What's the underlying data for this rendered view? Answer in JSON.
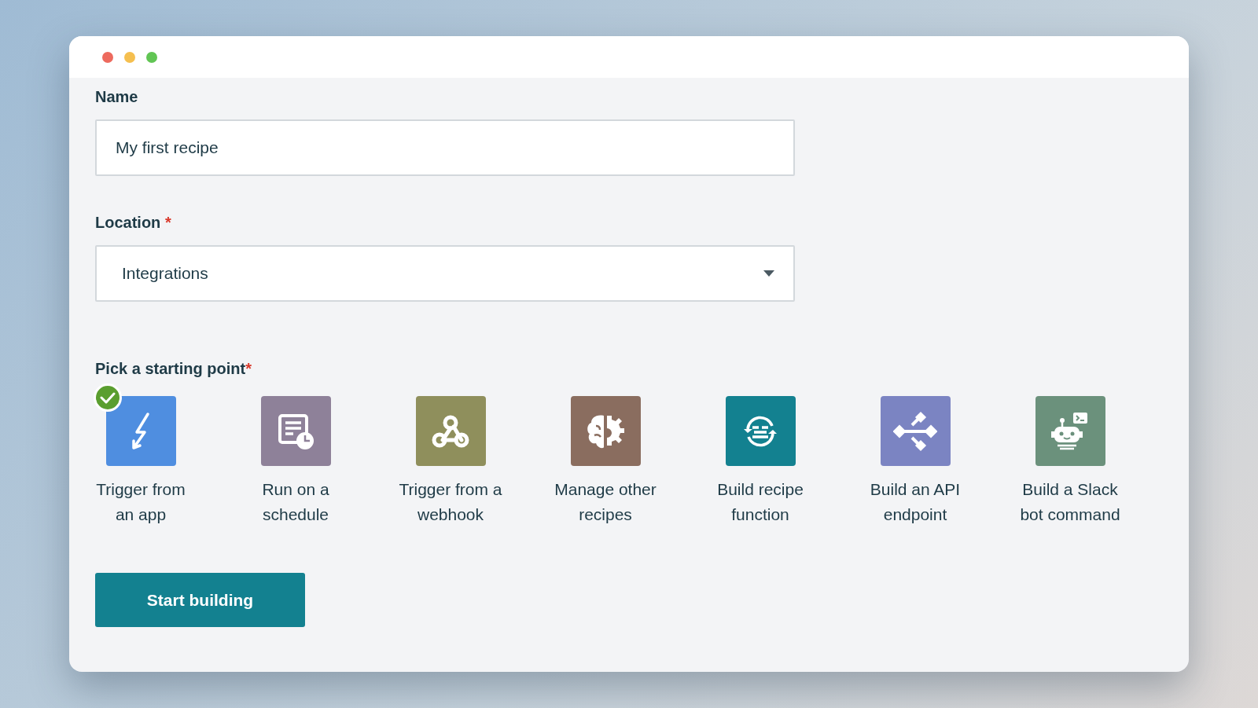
{
  "form": {
    "name_label": "Name",
    "name_value": "My first recipe",
    "location_label": "Location",
    "location_required": "*",
    "location_value": "Integrations",
    "start_label": "Pick a starting point",
    "start_required": "*"
  },
  "starting_points": [
    {
      "kind": "trigger",
      "label": "Trigger from an app",
      "color": "#4f8ee0",
      "selected": true
    },
    {
      "kind": "schedule",
      "label": "Run on a schedule",
      "color": "#8e8199",
      "selected": false
    },
    {
      "kind": "webhook",
      "label": "Trigger from a webhook",
      "color": "#8f8f5c",
      "selected": false
    },
    {
      "kind": "manage",
      "label": "Manage other recipes",
      "color": "#8a6d5f",
      "selected": false
    },
    {
      "kind": "function",
      "label": "Build recipe function",
      "color": "#138190",
      "selected": false
    },
    {
      "kind": "api",
      "label": "Build an API endpoint",
      "color": "#7b84c2",
      "selected": false
    },
    {
      "kind": "slack",
      "label": "Build a Slack bot command",
      "color": "#6b917c",
      "selected": false
    }
  ],
  "primary_button": "Start building"
}
